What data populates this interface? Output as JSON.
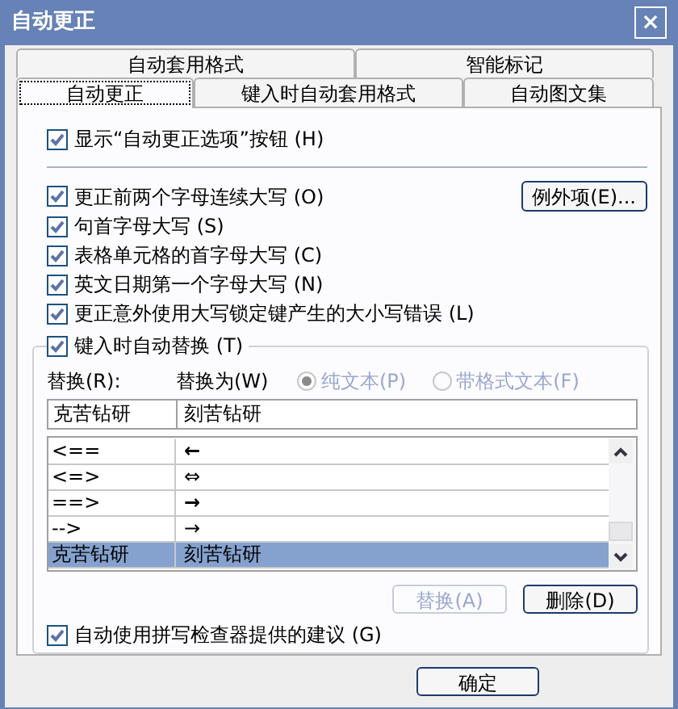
{
  "window": {
    "title": "自动更正",
    "close": "×"
  },
  "tab_rows": [
    [
      {
        "label": "自动套用格式",
        "selected": false
      },
      {
        "label": "智能标记",
        "selected": false
      }
    ],
    [
      {
        "label": "自动更正",
        "selected": true
      },
      {
        "label": "键入时自动套用格式",
        "selected": false
      },
      {
        "label": "自动图文集",
        "selected": false
      }
    ]
  ],
  "show_options": {
    "label": "显示“自动更正选项”按钮",
    "key": "(H)",
    "checked": true
  },
  "options": [
    {
      "label": "更正前两个字母连续大写",
      "key": "(O)",
      "checked": true
    },
    {
      "label": "句首字母大写",
      "key": "(S)",
      "checked": true
    },
    {
      "label": "表格单元格的首字母大写",
      "key": "(C)",
      "checked": true
    },
    {
      "label": "英文日期第一个字母大写",
      "key": "(N)",
      "checked": true
    },
    {
      "label": "更正意外使用大写锁定键产生的大小写错误",
      "key": "(L)",
      "checked": true
    }
  ],
  "exceptions_button": "例外项(E)...",
  "replace_group": {
    "label": "键入时自动替换",
    "key": "(T)",
    "checked": true,
    "replace_label": "替换(R):",
    "with_label": "替换为(W)",
    "radios": [
      {
        "label": "纯文本(P)",
        "selected": true,
        "disabled": true
      },
      {
        "label": "带格式文本(F)",
        "selected": false,
        "disabled": true
      }
    ],
    "replace_value": "克苦钻研",
    "with_value": "刻苦钻研",
    "rows": [
      {
        "from": "<==",
        "to": "←",
        "bold": true,
        "selected": false
      },
      {
        "from": "<=>",
        "to": "⇔",
        "bold": false,
        "selected": false
      },
      {
        "from": "==>",
        "to": "→",
        "bold": true,
        "selected": false
      },
      {
        "from": "-->",
        "to": "→",
        "bold": false,
        "selected": false
      },
      {
        "from": "克苦钻研",
        "to": "刻苦钻研",
        "bold": false,
        "selected": true
      }
    ],
    "buttons": [
      {
        "label": "替换(A)",
        "disabled": true
      },
      {
        "label": "删除(D)",
        "disabled": false
      }
    ]
  },
  "spell_option": {
    "label": "自动使用拼写检查器提供的建议",
    "key": "(G)",
    "checked": true
  },
  "ok_button": "确定"
}
